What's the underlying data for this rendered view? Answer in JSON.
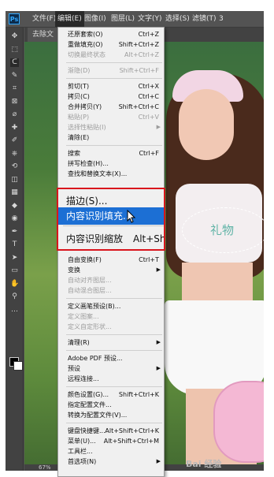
{
  "menubar": {
    "logo": "Ps",
    "items": [
      {
        "label": "文件(F)"
      },
      {
        "label": "编辑(E)"
      },
      {
        "label": "图像(I)"
      },
      {
        "label": "图层(L)"
      },
      {
        "label": "文字(Y)"
      },
      {
        "label": "选择(S)"
      },
      {
        "label": "滤镜(T)"
      },
      {
        "label": "3"
      }
    ]
  },
  "document_tab": {
    "label": "去除文"
  },
  "status_bar": {
    "zoom": "67%"
  },
  "edit_menu": [
    {
      "label": "还原套索(O)",
      "shortcut": "Ctrl+Z",
      "disabled": false
    },
    {
      "label": "重做填充(O)",
      "shortcut": "Shift+Ctrl+Z",
      "disabled": false
    },
    {
      "label": "切换最终状态",
      "shortcut": "Alt+Ctrl+Z",
      "disabled": true
    },
    {
      "sep": true
    },
    {
      "label": "渐隐(D)",
      "shortcut": "Shift+Ctrl+F",
      "disabled": true
    },
    {
      "sep": true
    },
    {
      "label": "剪切(T)",
      "shortcut": "Ctrl+X",
      "disabled": false
    },
    {
      "label": "拷贝(C)",
      "shortcut": "Ctrl+C",
      "disabled": false
    },
    {
      "label": "合并拷贝(Y)",
      "shortcut": "Shift+Ctrl+C",
      "disabled": false
    },
    {
      "label": "粘贴(P)",
      "shortcut": "Ctrl+V",
      "disabled": true
    },
    {
      "label": "选择性粘贴(I)",
      "shortcut": "",
      "disabled": true,
      "submenu": true
    },
    {
      "label": "清除(E)",
      "shortcut": "",
      "disabled": false
    },
    {
      "sep": true
    },
    {
      "label": "搜索",
      "shortcut": "Ctrl+F",
      "disabled": false
    },
    {
      "label": "拼写检查(H)...",
      "shortcut": "",
      "disabled": false
    },
    {
      "label": "查找和替换文本(X)...",
      "shortcut": "",
      "disabled": false
    }
  ],
  "highlighted_menu": {
    "stroke": {
      "label": "描边(S)..."
    },
    "content_aware_fill": {
      "label": "内容识别填充..."
    },
    "content_aware_scale": {
      "label": "内容识别缩放",
      "shortcut": "Alt+Shift"
    }
  },
  "edit_menu_lower": [
    {
      "label": "自由变换(F)",
      "shortcut": "Ctrl+T",
      "disabled": false
    },
    {
      "label": "变换",
      "shortcut": "",
      "disabled": false,
      "submenu": true
    },
    {
      "label": "自动对齐图层...",
      "shortcut": "",
      "disabled": true
    },
    {
      "label": "自动混合图层...",
      "shortcut": "",
      "disabled": true
    },
    {
      "sep": true
    },
    {
      "label": "定义画笔预设(B)...",
      "shortcut": "",
      "disabled": false
    },
    {
      "label": "定义图案...",
      "shortcut": "",
      "disabled": true
    },
    {
      "label": "定义自定形状...",
      "shortcut": "",
      "disabled": true
    },
    {
      "sep": true
    },
    {
      "label": "清理(R)",
      "shortcut": "",
      "disabled": false,
      "submenu": true
    },
    {
      "sep": true
    },
    {
      "label": "Adobe PDF 预设...",
      "shortcut": "",
      "disabled": false
    },
    {
      "label": "预设",
      "shortcut": "",
      "disabled": false,
      "submenu": true
    },
    {
      "label": "远程连接...",
      "shortcut": "",
      "disabled": false
    },
    {
      "sep": true
    },
    {
      "label": "颜色设置(G)...",
      "shortcut": "Shift+Ctrl+K",
      "disabled": false
    },
    {
      "label": "指定配置文件...",
      "shortcut": "",
      "disabled": false
    },
    {
      "label": "转换为配置文件(V)...",
      "shortcut": "",
      "disabled": false
    },
    {
      "sep": true
    },
    {
      "label": "键盘快捷键...",
      "shortcut": "Alt+Shift+Ctrl+K",
      "disabled": false
    },
    {
      "label": "菜单(U)...",
      "shortcut": "Alt+Shift+Ctrl+M",
      "disabled": false
    },
    {
      "label": "工具栏...",
      "shortcut": "",
      "disabled": false
    },
    {
      "label": "首选项(N)",
      "shortcut": "",
      "disabled": false,
      "submenu": true
    }
  ],
  "canvas": {
    "overlay_text": "礼物"
  },
  "watermark": {
    "text": "Bai 经验"
  },
  "tools": [
    "move-icon",
    "marquee-icon",
    "lasso-icon",
    "quick-select-icon",
    "crop-icon",
    "frame-icon",
    "eyedropper-icon",
    "healing-icon",
    "brush-icon",
    "stamp-icon",
    "history-brush-icon",
    "eraser-icon",
    "gradient-icon",
    "blur-icon",
    "dodge-icon",
    "pen-icon",
    "type-icon",
    "path-select-icon",
    "shape-icon",
    "hand-icon",
    "zoom-icon",
    "extra-icon"
  ]
}
